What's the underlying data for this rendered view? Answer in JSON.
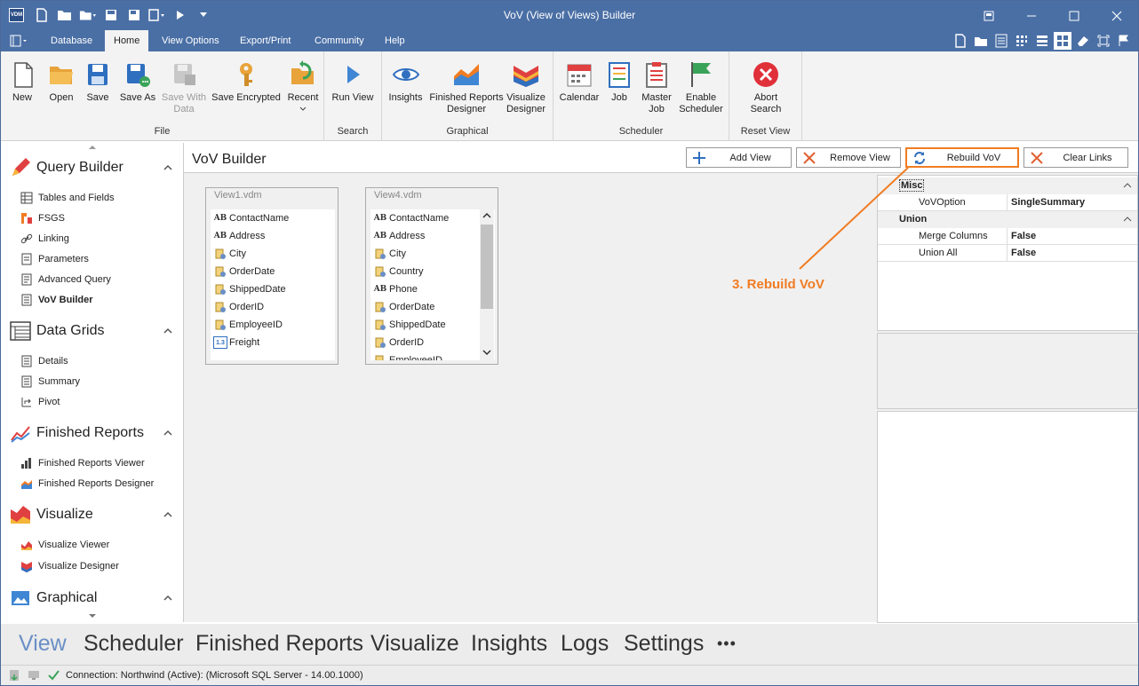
{
  "window": {
    "app_icon_label": "VDM",
    "title": "VoV (View of Views) Builder"
  },
  "menu": {
    "tabs": [
      "Database",
      "Home",
      "View Options",
      "Export/Print",
      "Community",
      "Help"
    ],
    "active_tab": "Home"
  },
  "ribbon": {
    "groups": {
      "file": "File",
      "search": "Search",
      "graphical": "Graphical",
      "scheduler": "Scheduler",
      "reset": "Reset View"
    },
    "buttons": {
      "new": "New",
      "open": "Open",
      "save": "Save",
      "save_as": "Save As",
      "save_with_data_1": "Save With",
      "save_with_data_2": "Data",
      "save_encrypted": "Save Encrypted",
      "recent": "Recent",
      "run_view": "Run View",
      "insights": "Insights",
      "finished_reports_1": "Finished Reports",
      "finished_reports_2": "Designer",
      "visualize_1": "Visualize",
      "visualize_2": "Designer",
      "calendar": "Calendar",
      "job": "Job",
      "master_job_1": "Master",
      "master_job_2": "Job",
      "enable_scheduler_1": "Enable",
      "enable_scheduler_2": "Scheduler",
      "abort_search_1": "Abort",
      "abort_search_2": "Search"
    }
  },
  "sidebar": {
    "sections": {
      "query_builder": {
        "title": "Query Builder",
        "items": [
          "Tables and Fields",
          "FSGS",
          "Linking",
          "Parameters",
          "Advanced Query",
          "VoV Builder"
        ]
      },
      "data_grids": {
        "title": "Data Grids",
        "items": [
          "Details",
          "Summary",
          "Pivot"
        ]
      },
      "finished_reports": {
        "title": "Finished Reports",
        "items": [
          "Finished Reports Viewer",
          "Finished Reports Designer"
        ]
      },
      "visualize": {
        "title": "Visualize",
        "items": [
          "Visualize Viewer",
          "Visualize Designer"
        ]
      },
      "graphical": {
        "title": "Graphical"
      }
    },
    "selected": "VoV Builder"
  },
  "main": {
    "title": "VoV Builder",
    "buttons": {
      "add_view": "Add View",
      "remove_view": "Remove View",
      "rebuild_vov": "Rebuild VoV",
      "clear_links": "Clear Links"
    },
    "views": [
      {
        "name": "View1.vdm",
        "fields": [
          {
            "name": "ContactName",
            "type": "text"
          },
          {
            "name": "Address",
            "type": "text"
          },
          {
            "name": "City",
            "type": "key"
          },
          {
            "name": "OrderDate",
            "type": "key"
          },
          {
            "name": "ShippedDate",
            "type": "key"
          },
          {
            "name": "OrderID",
            "type": "key"
          },
          {
            "name": "EmployeeID",
            "type": "key"
          },
          {
            "name": "Freight",
            "type": "num"
          }
        ]
      },
      {
        "name": "View4.vdm",
        "fields": [
          {
            "name": "ContactName",
            "type": "text"
          },
          {
            "name": "Address",
            "type": "text"
          },
          {
            "name": "City",
            "type": "key"
          },
          {
            "name": "Country",
            "type": "key"
          },
          {
            "name": "Phone",
            "type": "text"
          },
          {
            "name": "OrderDate",
            "type": "key"
          },
          {
            "name": "ShippedDate",
            "type": "key"
          },
          {
            "name": "OrderID",
            "type": "key"
          },
          {
            "name": "EmployeeID",
            "type": "key"
          }
        ]
      }
    ],
    "field_type_labels": {
      "text": "AB",
      "num": "1.3"
    },
    "callout": "3. Rebuild VoV",
    "callout_color": "#f07c23"
  },
  "properties": {
    "categories": [
      {
        "name": "Misc",
        "rows": [
          {
            "name": "VoVOption",
            "value": "SingleSummary"
          }
        ]
      },
      {
        "name": "Union",
        "rows": [
          {
            "name": "Merge Columns",
            "value": "False"
          },
          {
            "name": "Union All",
            "value": "False"
          }
        ]
      }
    ]
  },
  "bottom_nav": {
    "items": [
      "View",
      "Scheduler",
      "Finished Reports",
      "Visualize",
      "Insights",
      "Logs",
      "Settings"
    ],
    "more": "•••",
    "active": "View"
  },
  "status": {
    "connection": "Connection: Northwind (Active): (Microsoft SQL Server - 14.00.1000)"
  },
  "colors": {
    "titlebar": "#4a6fa5",
    "accent_orange": "#f07c23",
    "nav_active": "#6a8fc5"
  }
}
